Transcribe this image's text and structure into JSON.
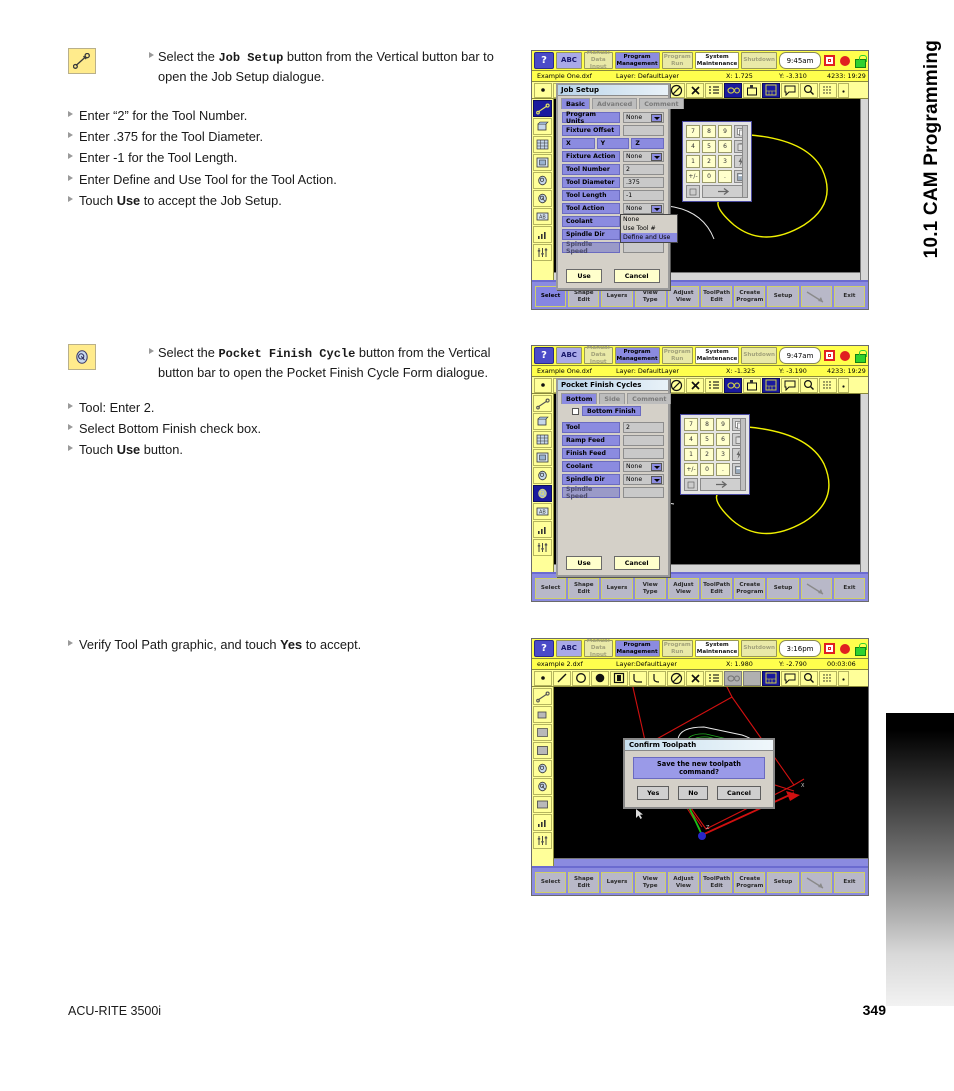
{
  "page": {
    "chapter_title": "10.1 CAM Programming",
    "footer_left": "ACU-RITE 3500i",
    "page_number": "349"
  },
  "blocks": [
    {
      "icon": "wrench-icon",
      "lead_prefix": "Select the ",
      "lead_mono": "Job Setup",
      "lead_suffix": " button from the Vertical button bar to open the Job Setup dialogue.",
      "bullets": [
        "Enter “2” for the Tool Number.",
        "Enter .375 for the Tool Diameter.",
        "Enter -1 for the Tool Length.",
        "Enter Define and Use Tool for the Tool Action.",
        "Touch Use to accept the Job Setup."
      ],
      "bullet_bold_last": "Use"
    },
    {
      "icon": "pocket-finish-icon",
      "lead_prefix": "Select the ",
      "lead_mono": "Pocket Finish Cycle",
      "lead_suffix": " button from the Vertical button bar to open the Pocket Finish Cycle Form dialogue.",
      "bullets": [
        "Tool: Enter 2.",
        "Select Bottom Finish check box.",
        "Touch Use button."
      ]
    },
    {
      "text_prefix": "Verify Tool Path graphic, and touch ",
      "text_bold": "Yes",
      "text_suffix": " to accept."
    }
  ],
  "screenshots": [
    {
      "id": "job-setup",
      "modebar": {
        "help": "?",
        "abc": "ABC",
        "buttons": [
          {
            "label": "Manual Data Input",
            "state": "dim"
          },
          {
            "label": "Program Management",
            "state": "active"
          },
          {
            "label": "Program Run",
            "state": "dim"
          },
          {
            "label": "System Maintenance",
            "state": "white"
          },
          {
            "label": "Shutdown",
            "state": "dim"
          }
        ],
        "clock": "9:45am"
      },
      "filebar": {
        "file": "Example One.dxf",
        "layer": "Layer: DefaultLayer",
        "x": "X:  1.725",
        "y": "Y:  -3.310",
        "time": "4233: 19:29"
      },
      "dialog": {
        "title": "Job Setup",
        "tabs": [
          "Basic",
          "Advanced",
          "Comment"
        ],
        "active_tab": "Basic",
        "fields": [
          {
            "label": "Program Units",
            "value": "None",
            "type": "combo"
          },
          {
            "label": "Fixture Offset",
            "value": "",
            "type": "text"
          },
          {
            "label": "Fixture Action",
            "value": "None",
            "type": "combo"
          },
          {
            "label": "Tool Number",
            "value": "2",
            "type": "text"
          },
          {
            "label": "Tool Diameter",
            "value": ".375",
            "type": "text"
          },
          {
            "label": "Tool Length",
            "value": "-1",
            "type": "text"
          },
          {
            "label": "Tool Action",
            "value": "None",
            "type": "combo"
          },
          {
            "label": "Coolant",
            "value": "",
            "type": "text"
          },
          {
            "label": "Spindle Dir",
            "value": "",
            "type": "text"
          },
          {
            "label": "Spindle Speed",
            "value": "",
            "type": "text"
          }
        ],
        "axis_labels": [
          "X",
          "Y",
          "Z"
        ],
        "dropdown_open": {
          "anchor": "Tool Action",
          "options": [
            "None",
            "Use Tool #",
            "Define and Use"
          ],
          "selected": "Define and Use"
        },
        "buttons": {
          "use": "Use",
          "cancel": "Cancel"
        }
      },
      "keypad": {
        "keys": [
          "7",
          "8",
          "9",
          "4",
          "5",
          "6",
          "1",
          "2",
          "3",
          "+/-",
          "0",
          "."
        ],
        "fn_keys": [
          "copy-icon",
          "paste-icon",
          "lightning-icon",
          "calc-icon"
        ],
        "bottom_keys": [
          "backspace-icon",
          "enter-icon"
        ]
      },
      "softkeys": [
        "Select",
        "Shape Edit",
        "Layers",
        "View Type",
        "Adjust View",
        "ToolPath Edit",
        "Create Program",
        "Setup",
        "",
        "Exit"
      ],
      "active_softkey": "Select"
    },
    {
      "id": "pocket-finish",
      "modebar": {
        "help": "?",
        "abc": "ABC",
        "buttons": [
          {
            "label": "Manual Data Input",
            "state": "dim"
          },
          {
            "label": "Program Management",
            "state": "active"
          },
          {
            "label": "Program Run",
            "state": "dim"
          },
          {
            "label": "System Maintenance",
            "state": "white"
          },
          {
            "label": "Shutdown",
            "state": "dim"
          }
        ],
        "clock": "9:47am"
      },
      "filebar": {
        "file": "Example One.dxf",
        "layer": "Layer: DefaultLayer",
        "x": "X:  -1.325",
        "y": "Y:  -3.190",
        "time": "4233: 19:29"
      },
      "dialog": {
        "title": "Pocket Finish Cycles",
        "tabs": [
          "Bottom",
          "Side",
          "Comment"
        ],
        "active_tab": "Bottom",
        "checkbox": {
          "label": "Bottom Finish",
          "checked": false
        },
        "fields": [
          {
            "label": "Tool",
            "value": "2",
            "type": "text"
          },
          {
            "label": "Ramp Feed",
            "value": "",
            "type": "text"
          },
          {
            "label": "Finish Feed",
            "value": "",
            "type": "text"
          },
          {
            "label": "Coolant",
            "value": "None",
            "type": "combo"
          },
          {
            "label": "Spindle Dir",
            "value": "None",
            "type": "combo"
          },
          {
            "label": "Spindle Speed",
            "value": "",
            "type": "text"
          }
        ],
        "buttons": {
          "use": "Use",
          "cancel": "Cancel"
        }
      },
      "softkeys": [
        "Select",
        "Shape Edit",
        "Layers",
        "View Type",
        "Adjust View",
        "ToolPath Edit",
        "Create Program",
        "Setup",
        "",
        "Exit"
      ],
      "active_softkey": ""
    },
    {
      "id": "confirm-toolpath",
      "modebar": {
        "help": "?",
        "abc": "ABC",
        "buttons": [
          {
            "label": "Manual Data Input",
            "state": "dim"
          },
          {
            "label": "Program Management",
            "state": "active"
          },
          {
            "label": "Program Run",
            "state": "dim"
          },
          {
            "label": "System Maintenance",
            "state": "white"
          },
          {
            "label": "Shutdown",
            "state": "dim"
          }
        ],
        "clock": "3:16pm"
      },
      "filebar": {
        "file": "example 2.dxf",
        "layer": "Layer:DefaultLayer",
        "x": "X:  1.980",
        "y": "Y:  -2.790",
        "time": "00:03:06"
      },
      "confirm": {
        "title": "Confirm Toolpath",
        "message": "Save the new toolpath command?",
        "buttons": [
          "Yes",
          "No",
          "Cancel"
        ]
      },
      "softkeys": [
        "Select",
        "Shape Edit",
        "Layers",
        "View Type",
        "Adjust View",
        "ToolPath Edit",
        "Create Program",
        "Setup",
        "",
        "Exit"
      ],
      "active_softkey": ""
    }
  ]
}
